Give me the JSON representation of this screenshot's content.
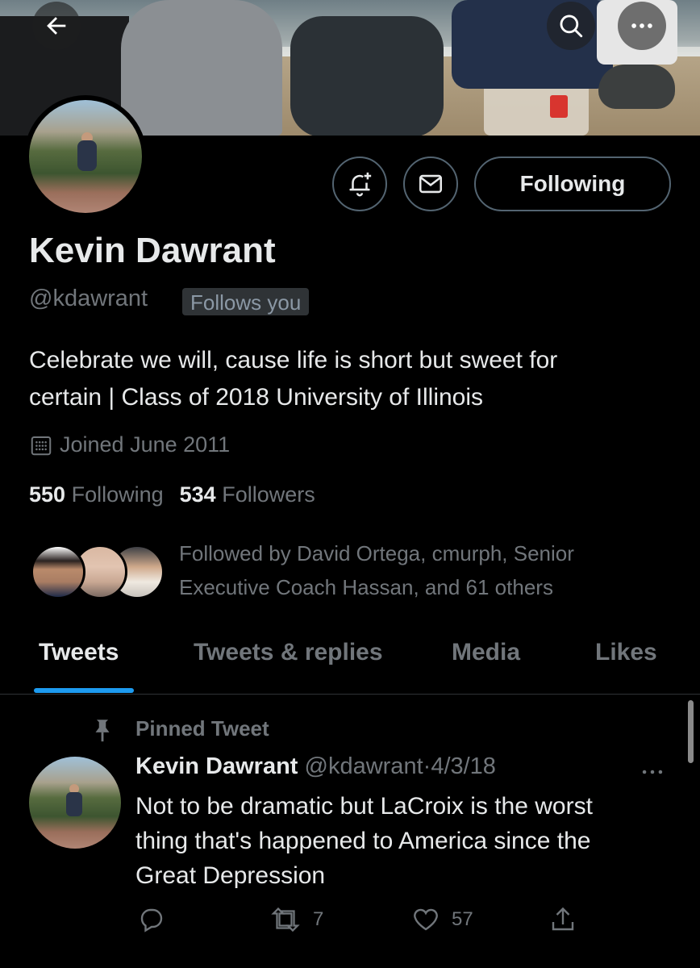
{
  "profile": {
    "name": "Kevin Dawrant",
    "handle": "@kdawrant",
    "follows_you": "Follows you",
    "bio_line1": "Celebrate we will, cause life is short but sweet for",
    "bio_line2": "certain | Class of 2018 University of Illinois",
    "joined": "Joined June 2011",
    "following_count": "550",
    "following_label": "Following",
    "followers_count": "534",
    "followers_label": "Followers",
    "followed_by_line1": "Followed by David Ortega, cmurph, Senior",
    "followed_by_line2": "Executive Coach Hassan, and 61 others"
  },
  "actions": {
    "following_button": "Following",
    "icons": [
      "back-arrow-icon",
      "search-icon",
      "more-icon",
      "notification-bell-plus-icon",
      "mail-icon"
    ]
  },
  "tabs": [
    {
      "label": "Tweets",
      "active": true
    },
    {
      "label": "Tweets & replies",
      "active": false
    },
    {
      "label": "Media",
      "active": false
    },
    {
      "label": "Likes",
      "active": false
    }
  ],
  "tweet": {
    "pinned_label": "Pinned Tweet",
    "author_name": "Kevin Dawrant",
    "author_handle": "@kdawrant",
    "separator": "·",
    "date": "4/3/18",
    "text_line1": "Not to be dramatic but LaCroix is the worst",
    "text_line2": "thing that's happened to America since the",
    "text_line3": "Great Depression",
    "reply_count": "",
    "retweet_count": "7",
    "like_count": "57"
  },
  "colors": {
    "background": "#000000",
    "text_primary": "#e7e9ea",
    "text_secondary": "#71767b",
    "accent": "#1d9bf0",
    "border": "#536471"
  }
}
